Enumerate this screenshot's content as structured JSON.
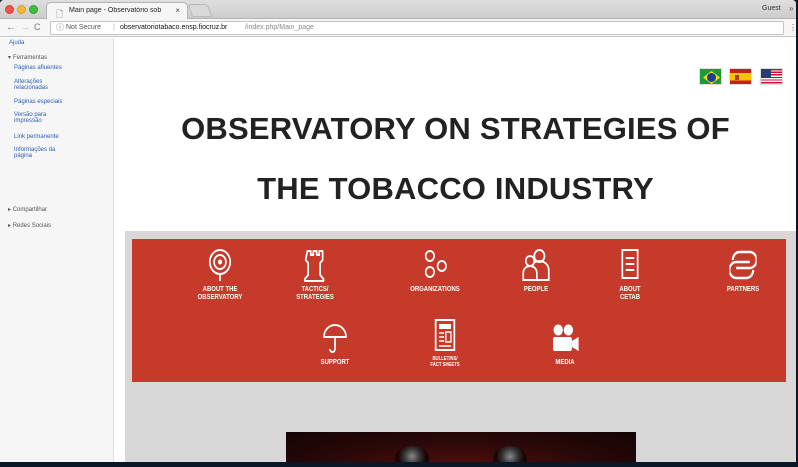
{
  "browser": {
    "tab_title": "Main page - Observatório sob",
    "tab_close": "×",
    "tab_favicon": "🗋",
    "user_label": "Guest",
    "more_glyph": "»",
    "back_glyph": "←",
    "forward_glyph": "→",
    "reload_glyph": "C",
    "security_icon": "ⓘ",
    "security_label": "Not Secure",
    "url_separator": "|",
    "url_host": "observatoriotabaco.ensp.fiocruz.br",
    "url_path": "/index.php/Main_page",
    "toolbar_more": "⋮"
  },
  "sidebar": {
    "help": "Ajuda",
    "tools_heading": "Ferramentas",
    "tools_arrow": "▾",
    "tools": [
      "Páginas afluentes",
      "Alterações\nrelacionadas",
      "Páginas especiais",
      "Versão para\nimpressão",
      "Link permanente",
      "Informações da\npágina"
    ],
    "share": "Compartilhar",
    "social": "Redes Sociais",
    "collapsed_arrow": "▸"
  },
  "hero": {
    "line1": "OBSERVATORY ON STRATEGIES OF",
    "line2": "THE TOBACCO INDUSTRY"
  },
  "flags": [
    "brazil-flag",
    "spain-flag",
    "usa-flag"
  ],
  "menu": {
    "items": [
      {
        "label": "ABOUT THE\nOBSERVATORY",
        "icon": "target-icon"
      },
      {
        "label": "TACTICS/\nSTRATEGIES",
        "icon": "chess-rook-icon"
      },
      {
        "label": "ORGANIZATIONS",
        "icon": "network-icon"
      },
      {
        "label": "PEOPLE",
        "icon": "people-icon"
      },
      {
        "label": "ABOUT\nCETAB",
        "icon": "document-icon"
      },
      {
        "label": "PARTNERS",
        "icon": "link-icon"
      },
      {
        "label": "SUPPORT",
        "icon": "umbrella-icon"
      },
      {
        "label": "BULLETINS/\nFACT SHEETS",
        "icon": "newspaper-icon"
      },
      {
        "label": "MEDIA",
        "icon": "video-camera-icon"
      }
    ]
  },
  "colors": {
    "menu_band": "#c63a2b",
    "panel_gray": "#d8d8d8",
    "link_blue": "#2a5db0"
  }
}
